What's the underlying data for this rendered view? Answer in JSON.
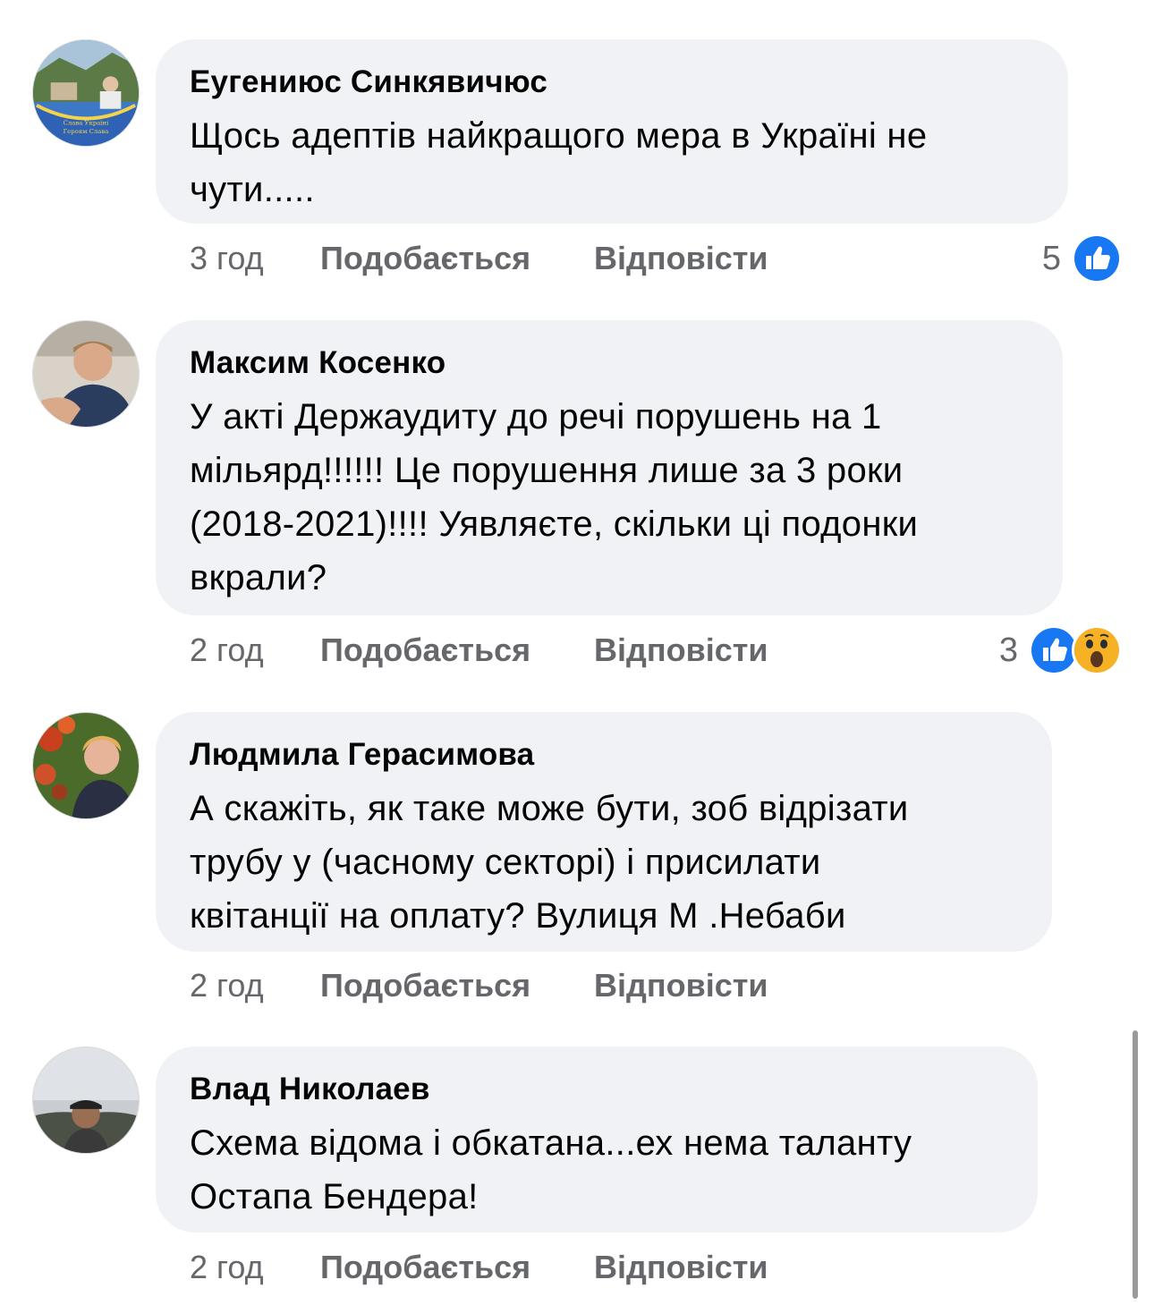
{
  "comments": [
    {
      "author": "Еугениюс Синкявичюс",
      "text_lines": [
        "Щось адептів найкращого мера в Україні не",
        "чути....."
      ],
      "time": "3 год",
      "like_label": "Подобається",
      "reply_label": "Відповісти",
      "reaction_count": "5",
      "reactions": [
        "like-icon"
      ]
    },
    {
      "author": "Максим Косенко",
      "text_lines": [
        "У акті Держаудиту до речі порушень на 1",
        "мільярд!!!!!! Це порушення лише за 3 роки",
        "(2018-2021)!!!! Уявляєте, скільки ці подонки",
        "вкрали?"
      ],
      "time": "2 год",
      "like_label": "Подобається",
      "reply_label": "Відповісти",
      "reaction_count": "3",
      "reactions": [
        "like-icon",
        "wow-icon"
      ]
    },
    {
      "author": "Людмила Герасимова",
      "text_lines": [
        "А скажіть, як таке може бути, зоб відрізати",
        "трубу у (часному секторі) і присилати",
        "квітанції на оплату? Вулиця М .Небаби"
      ],
      "time": "2 год",
      "like_label": "Подобається",
      "reply_label": "Відповісти"
    },
    {
      "author": "Влад Николаев",
      "text_lines": [
        "Схема відома і обкатана...ех нема таланту",
        "Остапа Бендера!"
      ],
      "time": "2 год",
      "like_label": "Подобається",
      "reply_label": "Відповісти"
    }
  ],
  "colors": {
    "bubble_bg": "#f0f2f5",
    "meta_text": "#65676b",
    "like_blue": "#1877f2",
    "wow_yellow": "#f7b125"
  }
}
